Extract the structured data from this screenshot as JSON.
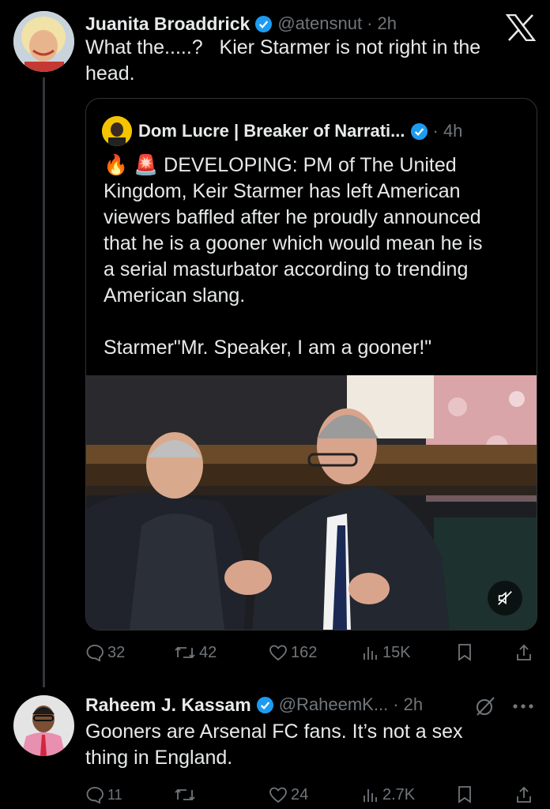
{
  "main_post": {
    "author": "Juanita Broaddrick",
    "handle": "@atensnut",
    "time": "· 2h",
    "text_line1": "What the.....?   Kier Starmer is not right in the",
    "text_line2": "head.",
    "stats": {
      "replies": "32",
      "reposts": "42",
      "likes": "162",
      "views": "15K"
    }
  },
  "quoted_post": {
    "author": "Dom Lucre | Breaker of Narrati...",
    "time": "· 4h",
    "emoji_prefix": "🔥 🚨",
    "line1": "DEVELOPING: PM of The United",
    "line2": "Kingdom, Keir Starmer has left American",
    "line3": "viewers baffled after he proudly announced",
    "line4": "that he is a gooner which would mean he is",
    "line5": "a serial masturbator according to trending",
    "line6": "American slang.",
    "line7": "Starmer\"Mr. Speaker, I am a gooner!\""
  },
  "reply_post": {
    "author": "Raheem J. Kassam",
    "handle": "@RaheemK...",
    "time": "· 2h",
    "text_line1": "Gooners are Arsenal FC fans. It’s not a sex",
    "text_line2": "thing in England.",
    "stats": {
      "replies": "11",
      "reposts": "",
      "likes": "24",
      "views": "2.7K"
    }
  },
  "colors": {
    "background": "#000000",
    "text": "#e7e9ea",
    "muted": "#71767b",
    "verified": "#1d9bf0",
    "border": "#2f3336"
  },
  "icons": [
    "x-logo-icon",
    "verified-icon",
    "reply-icon",
    "repost-icon",
    "like-icon",
    "views-icon",
    "bookmark-icon",
    "share-icon",
    "mute-icon",
    "grok-icon",
    "more-icon"
  ]
}
